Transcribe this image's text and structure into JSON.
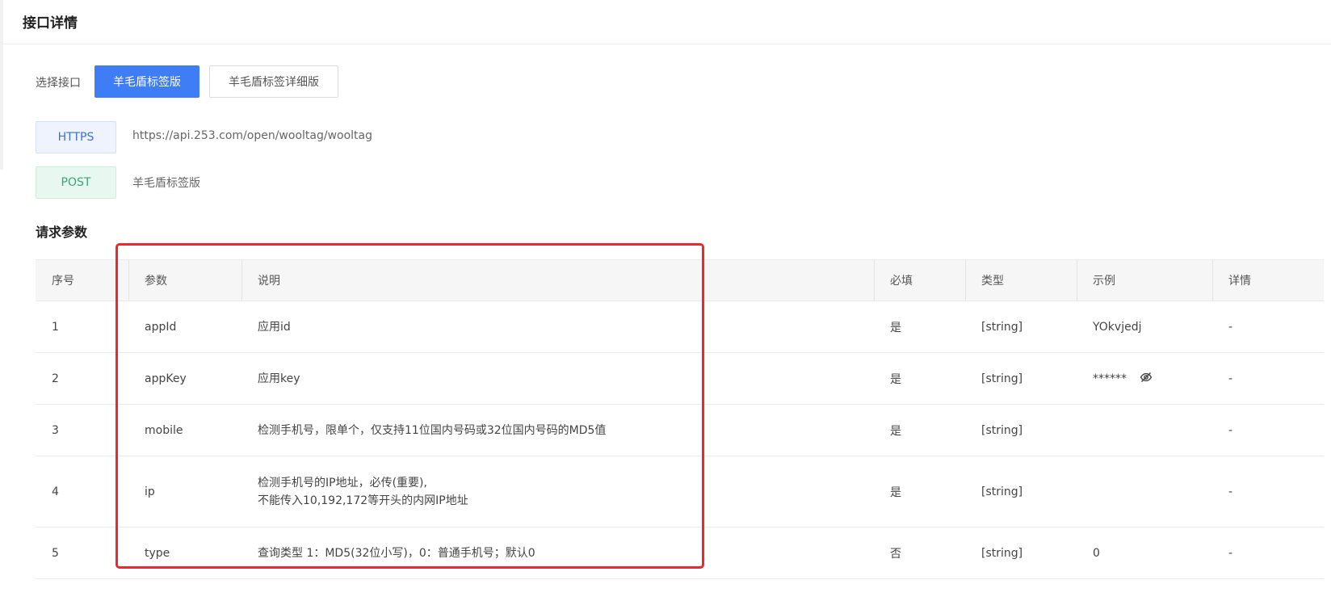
{
  "header": {
    "title": "接口详情"
  },
  "selector": {
    "label": "选择接口",
    "tabs": [
      {
        "label": "羊毛盾标签版",
        "active": true
      },
      {
        "label": "羊毛盾标签详细版",
        "active": false
      }
    ]
  },
  "endpoint": {
    "protocol": "HTTPS",
    "url": "https://api.253.com/open/wooltag/wooltag",
    "method": "POST",
    "name": "羊毛盾标签版"
  },
  "request_params": {
    "title": "请求参数",
    "columns": [
      "序号",
      "参数",
      "说明",
      "必填",
      "类型",
      "示例",
      "详情"
    ],
    "rows": [
      {
        "index": "1",
        "param": "appId",
        "desc": "应用id",
        "desc2": "",
        "required": "是",
        "type": "[string]",
        "example": "YOkvjedj",
        "detail": "-"
      },
      {
        "index": "2",
        "param": "appKey",
        "desc": "应用key",
        "desc2": "",
        "required": "是",
        "type": "[string]",
        "example": "******",
        "detail": "-"
      },
      {
        "index": "3",
        "param": "mobile",
        "desc": "检测手机号，限单个，仅支持11位国内号码或32位国内号码的MD5值",
        "desc2": "",
        "required": "是",
        "type": "[string]",
        "example": "",
        "detail": "-"
      },
      {
        "index": "4",
        "param": "ip",
        "desc": "检测手机号的IP地址，必传(重要),",
        "desc2": "不能传入10,192,172等开头的内网IP地址",
        "required": "是",
        "type": "[string]",
        "example": "",
        "detail": "-"
      },
      {
        "index": "5",
        "param": "type",
        "desc": "查询类型 1：MD5(32位小写)，0：普通手机号；默认0",
        "desc2": "",
        "required": "否",
        "type": "[string]",
        "example": "0",
        "detail": "-"
      }
    ]
  },
  "colors": {
    "accent": "#3f7df7",
    "highlight": "#f0262a",
    "post": "#33a874"
  },
  "icons": {
    "example_toggle": "eye-off-icon"
  }
}
